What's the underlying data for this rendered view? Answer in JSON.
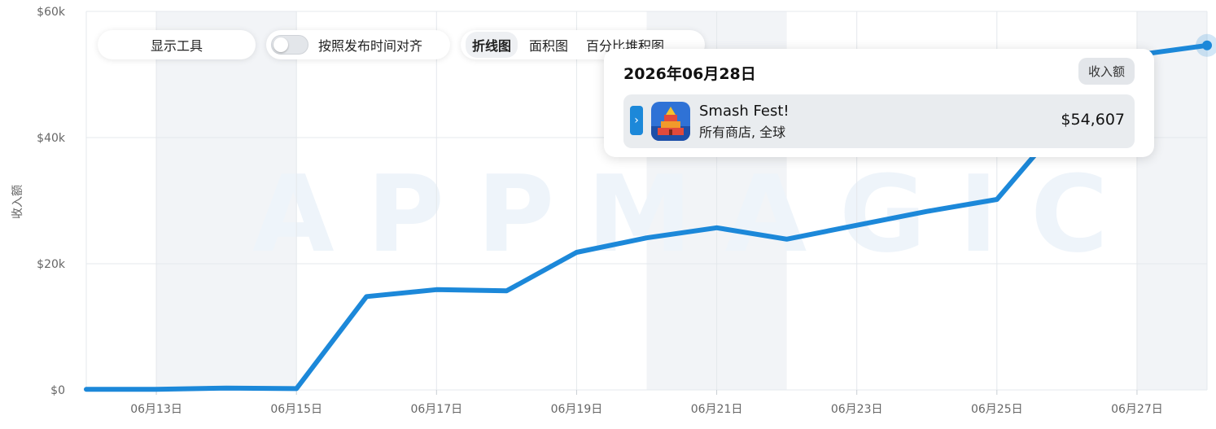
{
  "controls": {
    "tools_label": "显示工具",
    "align_label": "按照发布时间对齐",
    "chart_types": [
      "折线图",
      "面积图",
      "百分比堆积图"
    ],
    "active_type": "折线图"
  },
  "tooltip": {
    "date": "2026年06月28日",
    "metric_badge": "收入额",
    "app_name": "Smash Fest!",
    "app_subtitle": "所有商店, 全球",
    "value": "$54,607"
  },
  "watermark": "APPMAGIC",
  "colors": {
    "line": "#1c88d9",
    "grid": "#e4e8ec",
    "weekend_band": "#f2f4f7"
  },
  "chart_data": {
    "type": "line",
    "ylabel": "收入额",
    "ylim": [
      0,
      60000
    ],
    "y_ticks": [
      0,
      20000,
      40000,
      60000
    ],
    "y_tick_labels": [
      "$0",
      "$20k",
      "$40k",
      "$60k"
    ],
    "x_tick_labels": [
      "06月13日",
      "06月15日",
      "06月17日",
      "06月19日",
      "06月21日",
      "06月23日",
      "06月25日",
      "06月27日"
    ],
    "x_tick_dates": [
      "2026-06-13",
      "2026-06-15",
      "2026-06-17",
      "2026-06-19",
      "2026-06-21",
      "2026-06-23",
      "2026-06-25",
      "2026-06-27"
    ],
    "x_range": [
      "2026-06-12",
      "2026-06-28"
    ],
    "weekend_bands": [
      [
        "2026-06-13",
        "2026-06-15"
      ],
      [
        "2026-06-20",
        "2026-06-22"
      ],
      [
        "2026-06-27",
        "2026-06-28"
      ]
    ],
    "series": [
      {
        "name": "Smash Fest!",
        "points": [
          [
            "2026-06-12",
            100
          ],
          [
            "2026-06-13",
            100
          ],
          [
            "2026-06-14",
            300
          ],
          [
            "2026-06-15",
            200
          ],
          [
            "2026-06-16",
            14800
          ],
          [
            "2026-06-17",
            15900
          ],
          [
            "2026-06-18",
            15700
          ],
          [
            "2026-06-19",
            21800
          ],
          [
            "2026-06-20",
            24100
          ],
          [
            "2026-06-21",
            25700
          ],
          [
            "2026-06-22",
            23900
          ],
          [
            "2026-06-23",
            26100
          ],
          [
            "2026-06-24",
            28300
          ],
          [
            "2026-06-25",
            30200
          ],
          [
            "2026-06-26",
            43200
          ],
          [
            "2026-06-27",
            53100
          ],
          [
            "2026-06-28",
            54607
          ]
        ]
      }
    ],
    "highlighted_point": "2026-06-28"
  }
}
